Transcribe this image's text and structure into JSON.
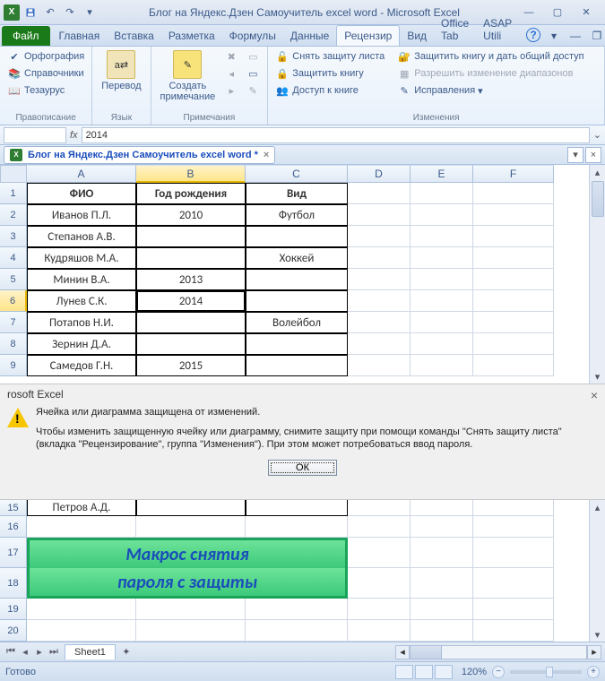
{
  "app_name": "Microsoft Excel",
  "doc_title": "Блог на Яндекс.Дзен Самоучитель excel word",
  "titlebar_text": "Блог на Яндекс.Дзен Самоучитель excel word  -  Microsoft Excel",
  "ribbon_tabs": {
    "file": "Файл",
    "items": [
      "Главная",
      "Вставка",
      "Разметка",
      "Формулы",
      "Данные",
      "Рецензир",
      "Вид",
      "Office Tab",
      "ASAP Utili"
    ]
  },
  "active_tab_index": 5,
  "ribbon_groups": {
    "proofing": {
      "label": "Правописание",
      "spell": "Орфография",
      "reference": "Справочники",
      "thesaurus": "Тезаурус"
    },
    "language": {
      "label": "Язык",
      "translate": "Перевод"
    },
    "comments": {
      "label": "Примечания",
      "new": "Создать\nпримечание"
    },
    "changes": {
      "label": "Изменения",
      "unprotect_sheet": "Снять защиту листа",
      "protect_book": "Защитить книгу",
      "share_book": "Доступ к книге",
      "protect_share": "Защитить книгу и дать общий доступ",
      "allow_ranges": "Разрешить изменение диапазонов",
      "track": "Исправления"
    }
  },
  "formula_bar": {
    "namebox": "",
    "fx": "fx",
    "value": "2014"
  },
  "doctab": {
    "name": "Блог на Яндекс.Дзен Самоучитель excel word *"
  },
  "columns": [
    "A",
    "B",
    "C",
    "D",
    "E",
    "F"
  ],
  "col_sel": "B",
  "row_headers_top": [
    "1",
    "2",
    "3",
    "4",
    "5",
    "6",
    "7",
    "8",
    "9"
  ],
  "row_sel": "6",
  "table": {
    "headers": {
      "a": "ФИО",
      "b": "Год рождения",
      "c": "Вид"
    },
    "rows": [
      {
        "a": "Иванов П.Л.",
        "b": "2010",
        "c": "Футбол"
      },
      {
        "a": "Степанов А.В.",
        "b": "",
        "c": ""
      },
      {
        "a": "Кудряшов М.А.",
        "b": "",
        "c": "Хоккей"
      },
      {
        "a": "Минин В.А.",
        "b": "2013",
        "c": ""
      },
      {
        "a": "Лунев С.К.",
        "b": "2014",
        "c": ""
      },
      {
        "a": "Потапов Н.И.",
        "b": "",
        "c": "Волейбол"
      },
      {
        "a": "Зернин Д.А.",
        "b": "",
        "c": ""
      },
      {
        "a": "Самедов Г.Н.",
        "b": "2015",
        "c": ""
      }
    ]
  },
  "selected_cell": "B6",
  "dialog": {
    "app": "rosoft Excel",
    "line1": "Ячейка или диаграмма защищена от изменений.",
    "line2": "Чтобы изменить защищенную ячейку или диаграмму, снимите защиту при помощи команды \"Снять защиту листа\" (вкладка \"Рецензирование\", группа \"Изменения\"). При этом может потребоваться ввод пароля.",
    "ok": "ОК"
  },
  "row_headers_bottom": [
    "15",
    "16",
    "17",
    "18",
    "19",
    "20"
  ],
  "row15": {
    "a": "Петров А.Д."
  },
  "macro_band": {
    "line1": "Макрос снятия",
    "line2": "пароля с защиты"
  },
  "sheettab": "Sheet1",
  "status": {
    "ready": "Готово",
    "zoom": "120%"
  }
}
